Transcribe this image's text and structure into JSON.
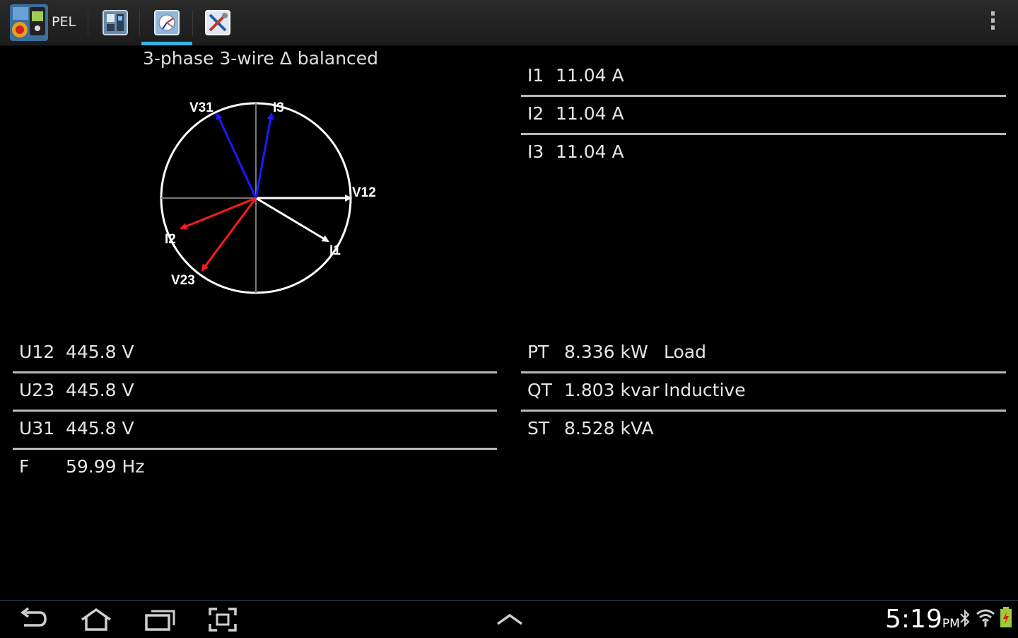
{
  "app": {
    "title": "PEL"
  },
  "tabs": [
    {
      "name": "meter-tab",
      "icon": "meter-icon",
      "selected": false
    },
    {
      "name": "phasor-tab",
      "icon": "phasor-chart-icon",
      "selected": true
    },
    {
      "name": "tools-tab",
      "icon": "tools-icon",
      "selected": false
    }
  ],
  "diagram": {
    "title": "3-phase 3-wire Δ balanced",
    "labels": {
      "v12": "V12",
      "v23": "V23",
      "v31": "V31",
      "i1": "I1",
      "i2": "I2",
      "i3": "I3"
    }
  },
  "currents": [
    {
      "label": "I1",
      "value": "11.04 A"
    },
    {
      "label": "I2",
      "value": "11.04 A"
    },
    {
      "label": "I3",
      "value": "11.04 A"
    }
  ],
  "voltages": [
    {
      "label": "U12",
      "value": "445.8 V"
    },
    {
      "label": "U23",
      "value": "445.8 V"
    },
    {
      "label": "U31",
      "value": "445.8 V"
    },
    {
      "label": "F",
      "value": "59.99 Hz"
    }
  ],
  "power": [
    {
      "label": "PT",
      "value": "8.336 kW",
      "note": "Load"
    },
    {
      "label": "QT",
      "value": "1.803 kvar",
      "note": "Inductive"
    },
    {
      "label": "ST",
      "value": "8.528 kVA",
      "note": ""
    }
  ],
  "status": {
    "time": "5:19",
    "ampm": "PM"
  },
  "colors": {
    "accent": "#33b5e5",
    "voltage": "#ffffff",
    "current_blue": "#1a1aff",
    "current_red": "#ff1a1a"
  }
}
